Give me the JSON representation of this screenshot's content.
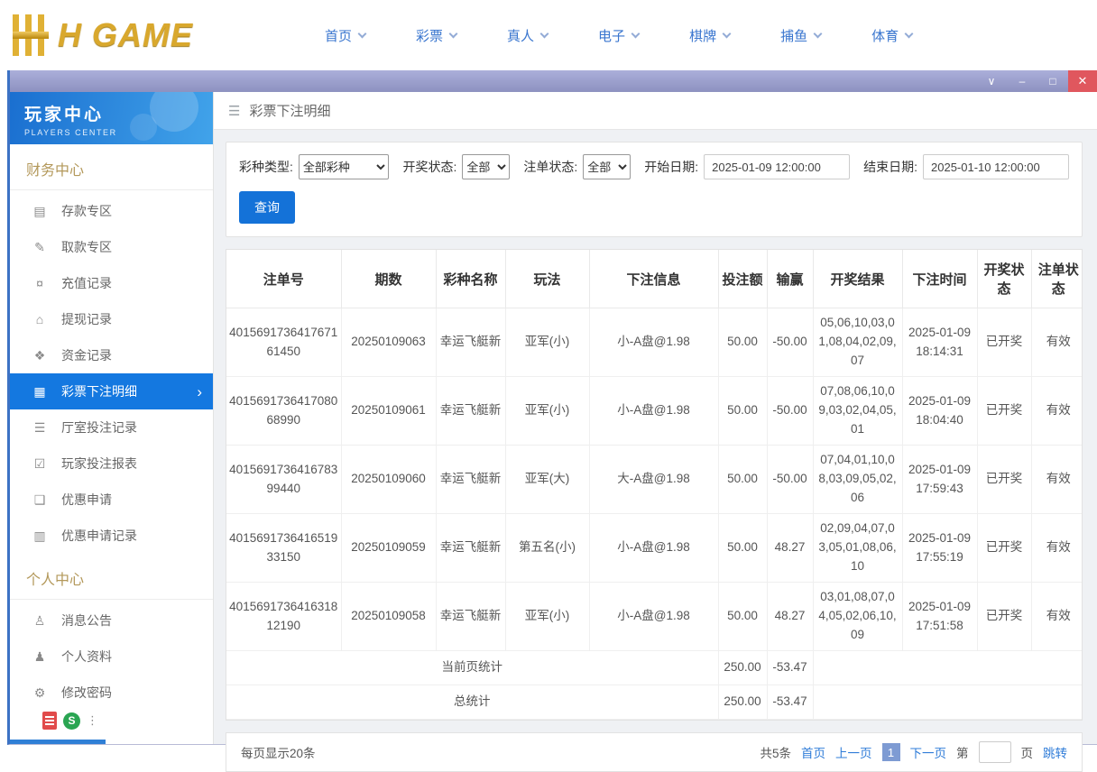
{
  "topbar": {
    "logo_text": "H GAME",
    "nav_items": [
      {
        "id": "home",
        "label": "首页"
      },
      {
        "id": "lottery",
        "label": "彩票"
      },
      {
        "id": "live",
        "label": "真人"
      },
      {
        "id": "electronic",
        "label": "电子"
      },
      {
        "id": "board-games",
        "label": "棋牌"
      },
      {
        "id": "fishing",
        "label": "捕鱼"
      },
      {
        "id": "sports",
        "label": "体育"
      }
    ]
  },
  "titlebar": {
    "controls": [
      {
        "id": "chevron",
        "name": "chevron-down-icon"
      },
      {
        "id": "minimize",
        "name": "minimize-icon"
      },
      {
        "id": "maximize",
        "name": "maximize-icon"
      },
      {
        "id": "close",
        "name": "close-icon"
      }
    ]
  },
  "sidebar": {
    "title": "玩家中心",
    "subtitle": "PLAYERS CENTER",
    "sections": [
      {
        "title": "财务中心",
        "items": [
          {
            "id": "deposit",
            "label": "存款专区",
            "icon": "deposit-card-icon"
          },
          {
            "id": "withdraw",
            "label": "取款专区",
            "icon": "withdraw-pen-icon"
          },
          {
            "id": "recharge-records",
            "label": "充值记录",
            "icon": "recharge-record-icon"
          },
          {
            "id": "withdrawal-records",
            "label": "提现记录",
            "icon": "withdrawal-record-icon"
          },
          {
            "id": "fund-records",
            "label": "资金记录",
            "icon": "fund-record-icon"
          },
          {
            "id": "lottery-bet-details",
            "label": "彩票下注明细",
            "icon": "bet-detail-icon",
            "active": true
          },
          {
            "id": "hall-bet-records",
            "label": "厅室投注记录",
            "icon": "hall-record-icon"
          },
          {
            "id": "player-bet-report",
            "label": "玩家投注报表",
            "icon": "report-icon"
          },
          {
            "id": "promo-apply",
            "label": "优惠申请",
            "icon": "promo-icon"
          },
          {
            "id": "promo-apply-records",
            "label": "优惠申请记录",
            "icon": "promo-record-icon"
          }
        ]
      },
      {
        "title": "个人中心",
        "items": [
          {
            "id": "messages",
            "label": "消息公告",
            "icon": "message-icon"
          },
          {
            "id": "profile",
            "label": "个人资料",
            "icon": "profile-icon"
          },
          {
            "id": "change-password",
            "label": "修改密码",
            "icon": "gear-icon"
          }
        ]
      }
    ]
  },
  "main": {
    "page_title": "彩票下注明细",
    "filters": {
      "lottery_type_label": "彩种类型:",
      "lottery_type_value": "全部彩种",
      "draw_status_label": "开奖状态:",
      "draw_status_value": "全部",
      "order_status_label": "注单状态:",
      "order_status_value": "全部",
      "start_date_label": "开始日期:",
      "start_date_value": "2025-01-09 12:00:00",
      "end_date_label": "结束日期:",
      "end_date_value": "2025-01-10 12:00:00",
      "search_button_label": "查询"
    },
    "table": {
      "headers": [
        "注单号",
        "期数",
        "彩种名称",
        "玩法",
        "下注信息",
        "投注额",
        "输赢",
        "开奖结果",
        "下注时间",
        "开奖状态",
        "注单状态"
      ],
      "rows": [
        [
          "401569173641767161450",
          "20250109063",
          "幸运飞艇新",
          "亚军(小)",
          "小-A盘@1.98",
          "50.00",
          "-50.00",
          "05,06,10,03,01,08,04,02,09,07",
          "2025-01-09 18:14:31",
          "已开奖",
          "有效"
        ],
        [
          "401569173641708068990",
          "20250109061",
          "幸运飞艇新",
          "亚军(小)",
          "小-A盘@1.98",
          "50.00",
          "-50.00",
          "07,08,06,10,09,03,02,04,05,01",
          "2025-01-09 18:04:40",
          "已开奖",
          "有效"
        ],
        [
          "401569173641678399440",
          "20250109060",
          "幸运飞艇新",
          "亚军(大)",
          "大-A盘@1.98",
          "50.00",
          "-50.00",
          "07,04,01,10,08,03,09,05,02,06",
          "2025-01-09 17:59:43",
          "已开奖",
          "有效"
        ],
        [
          "401569173641651933150",
          "20250109059",
          "幸运飞艇新",
          "第五名(小)",
          "小-A盘@1.98",
          "50.00",
          "48.27",
          "02,09,04,07,03,05,01,08,06,10",
          "2025-01-09 17:55:19",
          "已开奖",
          "有效"
        ],
        [
          "401569173641631812190",
          "20250109058",
          "幸运飞艇新",
          "亚军(小)",
          "小-A盘@1.98",
          "50.00",
          "48.27",
          "03,01,08,07,04,05,02,06,10,09",
          "2025-01-09 17:51:58",
          "已开奖",
          "有效"
        ]
      ],
      "summary_rows": [
        {
          "label": "当前页统计",
          "bet_total": "250.00",
          "winloss_total": "-53.47"
        },
        {
          "label": "总统计",
          "bet_total": "250.00",
          "winloss_total": "-53.47"
        }
      ]
    },
    "pagination": {
      "per_page_text": "每页显示20条",
      "total_text": "共5条",
      "first_label": "首页",
      "prev_label": "上一页",
      "current_page": "1",
      "next_label": "下一页",
      "jump_prefix": "第",
      "jump_suffix": "页",
      "jump_button_label": "跳转"
    }
  },
  "overlay_icons": {
    "wps_letter": "S"
  },
  "colors": {
    "accent_blue": "#1478e0",
    "button_blue": "#1472d8",
    "link_blue": "#2f7cd8",
    "gold": "#b3985a",
    "logo_gold": "#d9a82d",
    "titlebar_purple": "#8d91c0",
    "close_red": "#e0575e",
    "sidebar_header_blue": "#1a6fd0"
  }
}
